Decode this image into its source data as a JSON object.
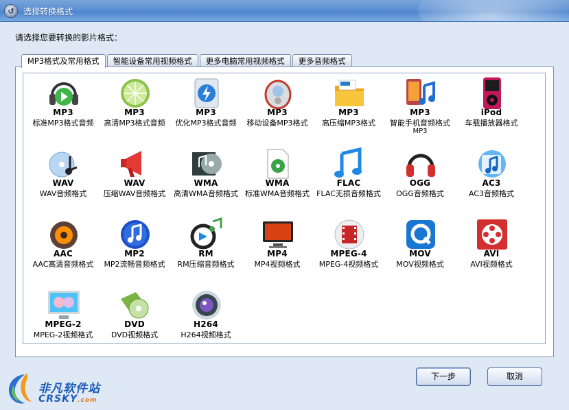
{
  "window": {
    "title": "选择转换格式"
  },
  "prompt": "请选择您要转换的影片格式：",
  "tabs": [
    {
      "label": "MP3格式及常用格式",
      "active": true
    },
    {
      "label": "智能设备常用视频格式",
      "active": false
    },
    {
      "label": "更多电脑常用视频格式",
      "active": false
    },
    {
      "label": "更多音频格式",
      "active": false
    }
  ],
  "formats": [
    {
      "name": "MP3",
      "desc": "标准MP3格式音频",
      "icon": "headphones-play-icon"
    },
    {
      "name": "MP3",
      "desc": "高清MP3格式音频",
      "icon": "lime-icon"
    },
    {
      "name": "MP3",
      "desc": "优化MP3格式音频",
      "icon": "lightning-icon"
    },
    {
      "name": "MP3",
      "desc": "移动设备MP3格式",
      "icon": "mobile-player-icon"
    },
    {
      "name": "MP3",
      "desc": "高压缩MP3格式",
      "icon": "folder-mp3-icon"
    },
    {
      "name": "MP3",
      "desc": "智能手机音频格式",
      "desc2": "MP3",
      "icon": "phone-music-icon"
    },
    {
      "name": "iPod",
      "desc": "车载播放器格式",
      "icon": "ipod-icon"
    },
    {
      "name": "WAV",
      "desc": "WAV音频格式",
      "icon": "cd-music-icon"
    },
    {
      "name": "WAV",
      "desc": "压缩WAV音频格式",
      "icon": "megaphone-icon"
    },
    {
      "name": "WMA",
      "desc": "高清WMA音频格式",
      "icon": "cd-case-icon"
    },
    {
      "name": "WMA",
      "desc": "标准WMA音频格式",
      "icon": "audio-file-icon"
    },
    {
      "name": "FLAC",
      "desc": "FLAC无损音频格式",
      "icon": "music-note-icon"
    },
    {
      "name": "OGG",
      "desc": "OGG音频格式",
      "icon": "red-headphones-icon"
    },
    {
      "name": "AC3",
      "desc": "AC3音频格式",
      "icon": "blue-note-icon"
    },
    {
      "name": "AAC",
      "desc": "AAC高清音频格式",
      "icon": "speaker-icon"
    },
    {
      "name": "MP2",
      "desc": "MP2流畅音频格式",
      "icon": "blue-circle-note-icon"
    },
    {
      "name": "RM",
      "desc": "RM压缩音频格式",
      "icon": "realmedia-icon"
    },
    {
      "name": "MP4",
      "desc": "MP4视频格式",
      "icon": "monitor-icon"
    },
    {
      "name": "MPEG-4",
      "desc": "MPEG-4视频格式",
      "icon": "film-circle-icon"
    },
    {
      "name": "MOV",
      "desc": "MOV视频格式",
      "icon": "quicktime-icon"
    },
    {
      "name": "AVI",
      "desc": "AVI视频格式",
      "icon": "film-reel-icon"
    },
    {
      "name": "MPEG-2",
      "desc": "MPEG-2视频格式",
      "icon": "tv-screen-icon"
    },
    {
      "name": "DVD",
      "desc": "DVD视频格式",
      "icon": "dvd-disc-icon"
    },
    {
      "name": "H264",
      "desc": "H264视频格式",
      "icon": "camera-lens-icon"
    }
  ],
  "buttons": {
    "next": "下一步",
    "cancel": "取消"
  },
  "logo": {
    "cn": "非凡软件站",
    "en": "CRSKY",
    "en_suffix": ".com"
  }
}
